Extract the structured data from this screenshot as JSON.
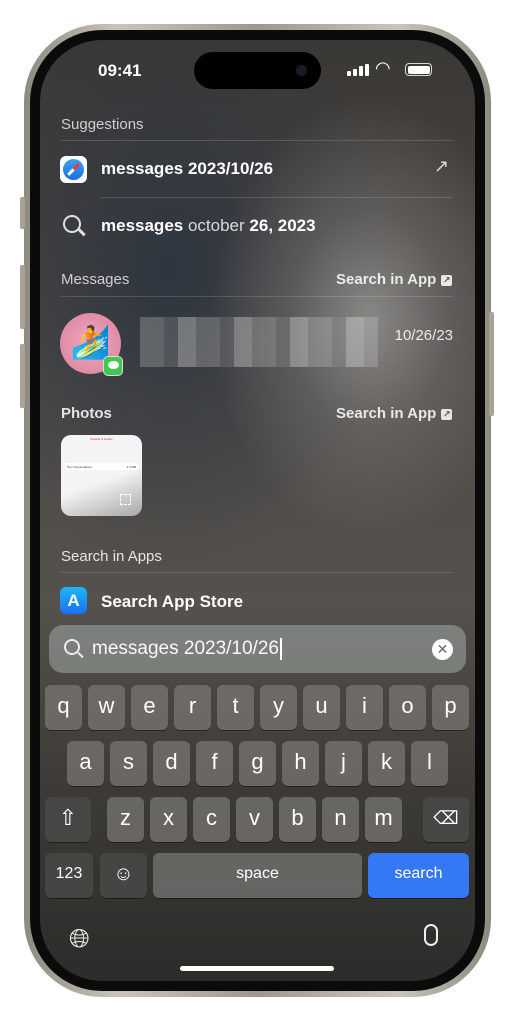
{
  "status": {
    "time": "09:41"
  },
  "suggestions": {
    "header": "Suggestions",
    "items": [
      {
        "text": "messages 2023/10/26",
        "icon": "safari-icon",
        "action": "arrow-up-right-icon"
      },
      {
        "text_bold": "messages",
        "text_light": "october",
        "text_bold2": "26, 2023",
        "icon": "search-icon"
      }
    ]
  },
  "messages": {
    "header": "Messages",
    "search_in_app": "Search in App",
    "result": {
      "date": "10/26/23",
      "avatar": "surfer-memoji"
    }
  },
  "photos": {
    "header": "Photos",
    "search_in_app": "Search in App",
    "thumb": {
      "title": "Disable & Delete",
      "row": "Top Conversations",
      "size": "2.4 MB"
    }
  },
  "search_in_apps": {
    "header": "Search in Apps",
    "items": [
      {
        "label": "Search App Store",
        "icon": "app-store-icon"
      }
    ]
  },
  "search_field": {
    "value": "messages 2023/10/26"
  },
  "keyboard": {
    "row1": [
      "q",
      "w",
      "e",
      "r",
      "t",
      "y",
      "u",
      "i",
      "o",
      "p"
    ],
    "row2": [
      "a",
      "s",
      "d",
      "f",
      "g",
      "h",
      "j",
      "k",
      "l"
    ],
    "row3": [
      "z",
      "x",
      "c",
      "v",
      "b",
      "n",
      "m"
    ],
    "numbers": "123",
    "space": "space",
    "search": "search",
    "search_color": "#3478f6"
  }
}
